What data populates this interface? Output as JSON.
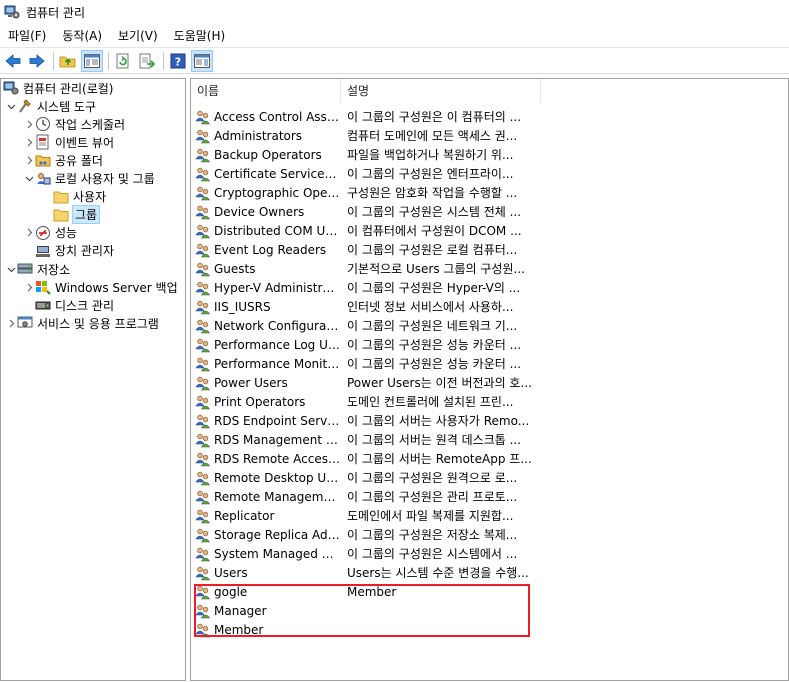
{
  "window": {
    "title": "컴퓨터 관리"
  },
  "menu": [
    "파일(F)",
    "동작(A)",
    "보기(V)",
    "도움말(H)"
  ],
  "toolbar": {
    "buttons": [
      "back-icon",
      "forward-icon",
      "up-folder-icon",
      "show-hide-tree-icon",
      "refresh-icon",
      "export-list-icon",
      "help-icon",
      "properties-view-icon"
    ]
  },
  "tree": [
    {
      "label": "컴퓨터 관리(로컬)",
      "level": 0,
      "expander": "",
      "icon": "computer-management-icon"
    },
    {
      "label": "시스템 도구",
      "level": 1,
      "expander": "expanded",
      "icon": "system-tools-icon"
    },
    {
      "label": "작업 스케줄러",
      "level": 2,
      "expander": "collapsed",
      "icon": "clock-icon"
    },
    {
      "label": "이벤트 뷰어",
      "level": 2,
      "expander": "collapsed",
      "icon": "event-viewer-icon"
    },
    {
      "label": "공유 폴더",
      "level": 2,
      "expander": "collapsed",
      "icon": "shared-folder-icon"
    },
    {
      "label": "로컬 사용자 및 그룹",
      "level": 2,
      "expander": "expanded",
      "icon": "local-users-icon"
    },
    {
      "label": "사용자",
      "level": 3,
      "expander": "",
      "icon": "folder-icon"
    },
    {
      "label": "그룹",
      "level": 3,
      "expander": "",
      "icon": "folder-icon",
      "selected": true
    },
    {
      "label": "성능",
      "level": 2,
      "expander": "collapsed",
      "icon": "performance-icon"
    },
    {
      "label": "장치 관리자",
      "level": 2,
      "expander": "",
      "icon": "device-manager-icon"
    },
    {
      "label": "저장소",
      "level": 1,
      "expander": "expanded",
      "icon": "storage-icon"
    },
    {
      "label": "Windows Server 백업",
      "level": 2,
      "expander": "collapsed",
      "icon": "backup-icon"
    },
    {
      "label": "디스크 관리",
      "level": 2,
      "expander": "",
      "icon": "disk-icon"
    },
    {
      "label": "서비스 및 응용 프로그램",
      "level": 1,
      "expander": "collapsed",
      "icon": "services-icon"
    }
  ],
  "list": {
    "columns": [
      "이름",
      "설명"
    ],
    "rows": [
      {
        "name": "Access Control Assist...",
        "desc": "이 그룹의 구성원은 이 컴퓨터의 ..."
      },
      {
        "name": "Administrators",
        "desc": "컴퓨터 도메인에 모든 액세스 권..."
      },
      {
        "name": "Backup Operators",
        "desc": "파일을 백업하거나 복원하기 위..."
      },
      {
        "name": "Certificate Service DC...",
        "desc": "이 그룹의 구성원은 엔터프라이..."
      },
      {
        "name": "Cryptographic Operat...",
        "desc": "구성원은 암호화 작업을 수행할 ..."
      },
      {
        "name": "Device Owners",
        "desc": "이 그룹의 구성원은 시스템 전체 ..."
      },
      {
        "name": "Distributed COM Users",
        "desc": "이 컴퓨터에서 구성원이 DCOM ..."
      },
      {
        "name": "Event Log Readers",
        "desc": "이 그룹의 구성원은 로컬 컴퓨터..."
      },
      {
        "name": "Guests",
        "desc": "기본적으로 Users 그룹의 구성원..."
      },
      {
        "name": "Hyper-V Administrat...",
        "desc": "이 그룹의 구성원은 Hyper-V의 ..."
      },
      {
        "name": "IIS_IUSRS",
        "desc": "인터넷 정보 서비스에서 사용하..."
      },
      {
        "name": "Network Configuratio...",
        "desc": "이 그룹의 구성원은 네트워크 기..."
      },
      {
        "name": "Performance Log Users",
        "desc": "이 그룹의 구성원은 성능 카운터 ..."
      },
      {
        "name": "Performance Monitor...",
        "desc": "이 그룹의 구성원은 성능 카운터 ..."
      },
      {
        "name": "Power Users",
        "desc": "Power Users는 이전 버전과의 호..."
      },
      {
        "name": "Print Operators",
        "desc": "도메인 컨트롤러에 설치된 프린..."
      },
      {
        "name": "RDS Endpoint Servers",
        "desc": "이 그룹의 서버는 사용자가 Remo..."
      },
      {
        "name": "RDS Management Se...",
        "desc": "이 그룹의 서버는 원격 데스크톱 ..."
      },
      {
        "name": "RDS Remote Access ...",
        "desc": "이 그룹의 서버는 RemoteApp 프..."
      },
      {
        "name": "Remote Desktop Users",
        "desc": "이 그룹의 구성원은 원격으로 로..."
      },
      {
        "name": "Remote Management...",
        "desc": "이 그룹의 구성원은 관리 프로토..."
      },
      {
        "name": "Replicator",
        "desc": "도메인에서 파일 복제를 지원합..."
      },
      {
        "name": "Storage Replica Admi...",
        "desc": "이 그룹의 구성원은 저장소 복제..."
      },
      {
        "name": "System Managed Acc...",
        "desc": "이 그룹의 구성원은 시스템에서 ..."
      },
      {
        "name": "Users",
        "desc": "Users는 시스템 수준 변경을 수행..."
      },
      {
        "name": "gogle",
        "desc": "Member"
      },
      {
        "name": "Manager",
        "desc": ""
      },
      {
        "name": "Member",
        "desc": ""
      }
    ]
  },
  "colors": {
    "highlight_box": "#ee1c24",
    "selection": "#cce8ff"
  }
}
